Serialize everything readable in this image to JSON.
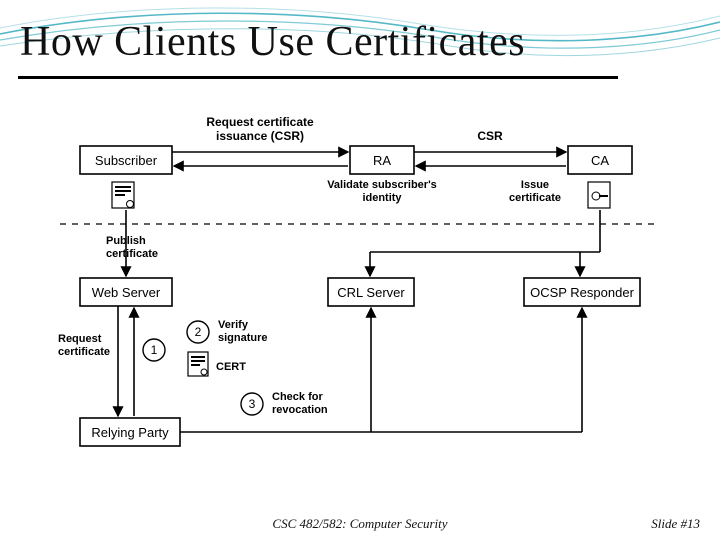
{
  "title": "How Clients Use Certificates",
  "footer": {
    "center": "CSC 482/582: Computer Security",
    "right": "Slide #13"
  },
  "diagram": {
    "nodes": {
      "subscriber": "Subscriber",
      "ra": "RA",
      "ca": "CA",
      "webserver": "Web Server",
      "crl": "CRL Server",
      "ocsp": "OCSP Responder",
      "relying": "Relying Party"
    },
    "edges": {
      "csr_request_l1": "Request certificate",
      "csr_request_l2": "issuance (CSR)",
      "csr": "CSR",
      "validate_l1": "Validate subscriber's",
      "validate_l2": "identity",
      "issue_l1": "Issue",
      "issue_l2": "certificate",
      "publish_l1": "Publish",
      "publish_l2": "certificate",
      "request_l1": "Request",
      "request_l2": "certificate",
      "verify_l1": "Verify",
      "verify_l2": "signature",
      "revoke_l1": "Check for",
      "revoke_l2": "revocation",
      "cert": "CERT"
    },
    "steps": {
      "s1": "1",
      "s2": "2",
      "s3": "3"
    }
  }
}
